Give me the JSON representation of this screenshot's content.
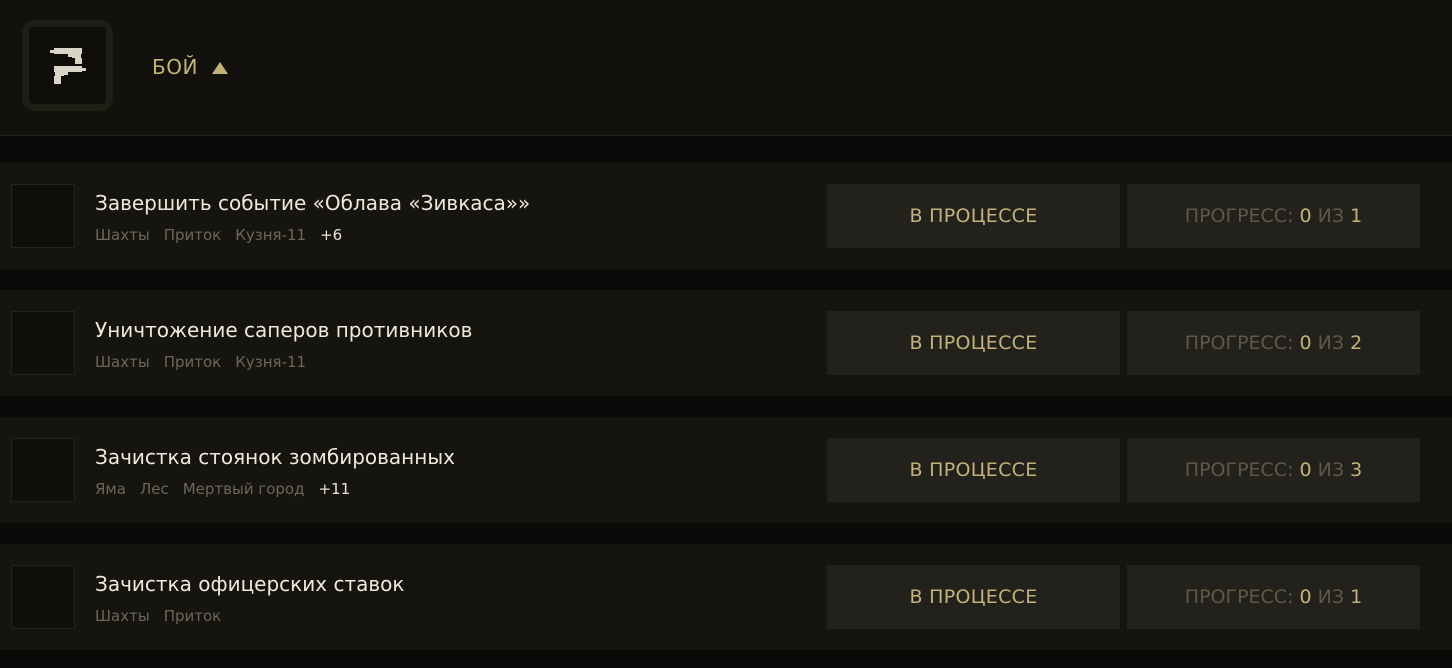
{
  "category": {
    "title": "БОЙ",
    "icon": "pistols-icon",
    "caret": "caret-up-icon",
    "accent": "#c4b27c"
  },
  "tasks": [
    {
      "title": "Завершить событие «Облава «Зивкаса»»",
      "tags": [
        "Шахты",
        "Приток",
        "Кузня-11"
      ],
      "more": "+6",
      "status": "В ПРОЦЕССЕ",
      "progress": {
        "label": "ПРОГРЕСС:",
        "current": "0",
        "sep": "ИЗ",
        "total": "1"
      }
    },
    {
      "title": "Уничтожение саперов противников",
      "tags": [
        "Шахты",
        "Приток",
        "Кузня-11"
      ],
      "more": "",
      "status": "В ПРОЦЕССЕ",
      "progress": {
        "label": "ПРОГРЕСС:",
        "current": "0",
        "sep": "ИЗ",
        "total": "2"
      }
    },
    {
      "title": "Зачистка стоянок зомбированных",
      "tags": [
        "Яма",
        "Лес",
        "Мертвый город"
      ],
      "more": "+11",
      "status": "В ПРОЦЕССЕ",
      "progress": {
        "label": "ПРОГРЕСС:",
        "current": "0",
        "sep": "ИЗ",
        "total": "3"
      }
    },
    {
      "title": "Зачистка офицерских ставок",
      "tags": [
        "Шахты",
        "Приток"
      ],
      "more": "",
      "status": "В ПРОЦЕССЕ",
      "progress": {
        "label": "ПРОГРЕСС:",
        "current": "0",
        "sep": "ИЗ",
        "total": "1"
      }
    }
  ]
}
